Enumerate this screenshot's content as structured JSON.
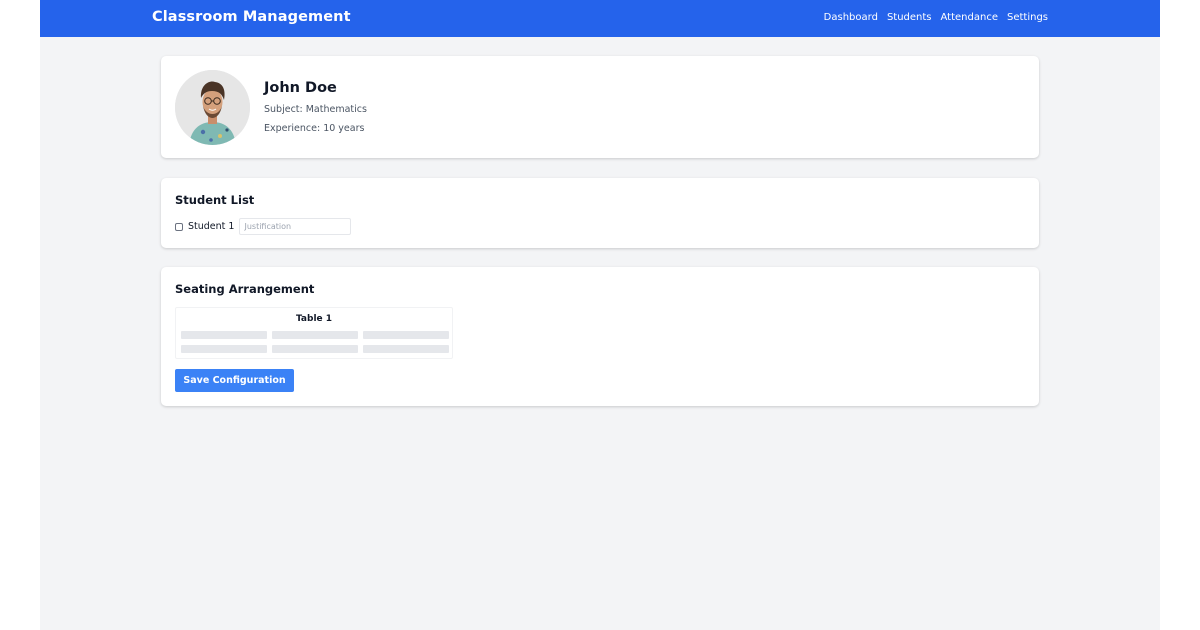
{
  "header": {
    "brand": "Classroom Management",
    "nav": [
      "Dashboard",
      "Students",
      "Attendance",
      "Settings"
    ],
    "accent_color": "#2563eb"
  },
  "profile": {
    "name": "John Doe",
    "subject": "Subject: Mathematics",
    "experience": "Experience: 10 years",
    "avatar_icon": "teacher-avatar-photo"
  },
  "students": {
    "title": "Student List",
    "items": [
      {
        "label": "Student 1",
        "checked": false,
        "justification_value": "",
        "justification_placeholder": "Justification"
      }
    ]
  },
  "seating": {
    "title": "Seating Arrangement",
    "tables": [
      {
        "label": "Table 1",
        "rows": 2,
        "columns": 3
      }
    ],
    "save_label": "Save Configuration",
    "button_color": "#3b82f6"
  }
}
